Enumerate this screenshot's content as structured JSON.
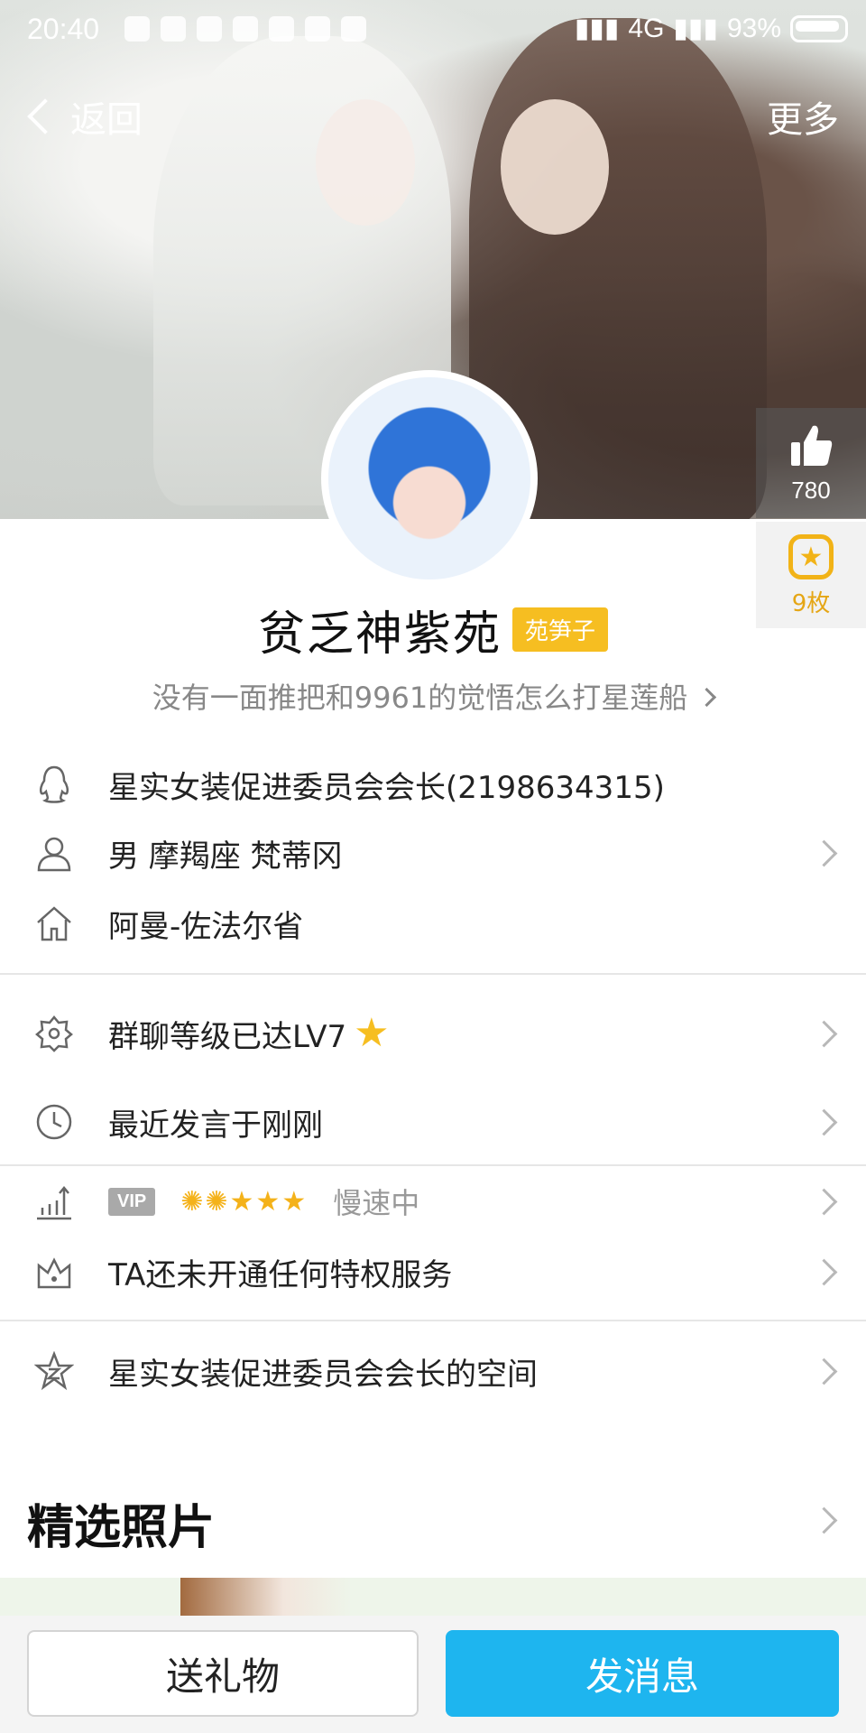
{
  "status_bar": {
    "time": "20:40",
    "network": "4G",
    "battery": "93%"
  },
  "nav": {
    "back_label": "返回",
    "more_label": "更多"
  },
  "like": {
    "count": "780",
    "icon": "thumbs-up-icon"
  },
  "medal": {
    "count": "9枚",
    "icon": "star-medal-icon"
  },
  "profile": {
    "name": "贫乏神紫苑",
    "badge": "苑笋子",
    "signature": "没有一面推把和9961的觉悟怎么打星莲船"
  },
  "info": {
    "qq_line": "星实女装促进委员会会长(2198634315)",
    "person_line": "男  摩羯座  梵蒂冈",
    "home_line": "阿曼-佐法尔省"
  },
  "group": {
    "level_text": "群聊等级已达LV7",
    "recent_text": "最近发言于刚刚"
  },
  "vip": {
    "tag": "VIP",
    "speed_text": "慢速中",
    "privilege_text": "TA还未开通任何特权服务"
  },
  "space": {
    "text": "星实女装促进委员会会长的空间"
  },
  "photos": {
    "title": "精选照片"
  },
  "bottom": {
    "gift_label": "送礼物",
    "message_label": "发消息"
  },
  "colors": {
    "accent_blue": "#1eb5ef",
    "badge_yellow": "#f6be21"
  }
}
